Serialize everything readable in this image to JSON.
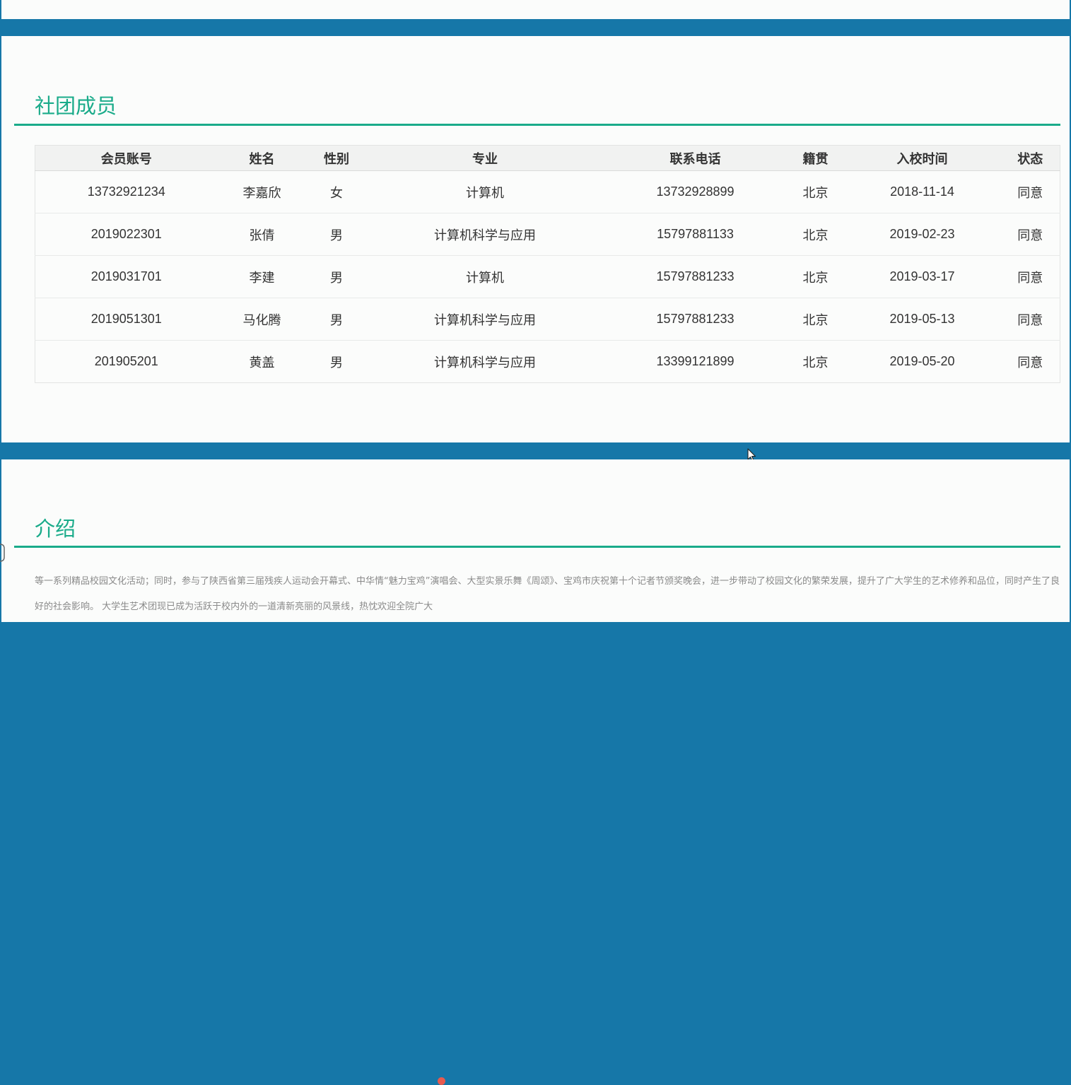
{
  "members_section": {
    "title": "社团成员",
    "columns": [
      "会员账号",
      "姓名",
      "性别",
      "专业",
      "联系电话",
      "籍贯",
      "入校时间",
      "状态"
    ],
    "rows": [
      [
        "13732921234",
        "李嘉欣",
        "女",
        "计算机",
        "13732928899",
        "北京",
        "2018-11-14",
        "同意"
      ],
      [
        "2019022301",
        "张倩",
        "男",
        "计算机科学与应用",
        "15797881133",
        "北京",
        "2019-02-23",
        "同意"
      ],
      [
        "2019031701",
        "李建",
        "男",
        "计算机",
        "15797881233",
        "北京",
        "2019-03-17",
        "同意"
      ],
      [
        "2019051301",
        "马化腾",
        "男",
        "计算机科学与应用",
        "15797881233",
        "北京",
        "2019-05-13",
        "同意"
      ],
      [
        "201905201",
        "黄盖",
        "男",
        "计算机科学与应用",
        "13399121899",
        "北京",
        "2019-05-20",
        "同意"
      ]
    ]
  },
  "intro_section": {
    "title": "介绍",
    "text": "等一系列精品校园文化活动；同时，参与了陕西省第三届残疾人运动会开幕式、中华情“魅力宝鸡”演唱会、大型实景乐舞《周颂》、宝鸡市庆祝第十个记者节颁奖晚会，进一步带动了校园文化的繁荣发展，提升了广大学生的艺术修养和品位，同时产生了良好的社会影响。 大学生艺术团现已成为活跃于校内外的一道清新亮丽的风景线，热忱欢迎全院广大"
  },
  "colors": {
    "band": "#1677a8",
    "accent": "#1aab8a",
    "panel": "#fbfcfb"
  },
  "icons": {
    "cursor": "mouse-pointer-icon"
  }
}
